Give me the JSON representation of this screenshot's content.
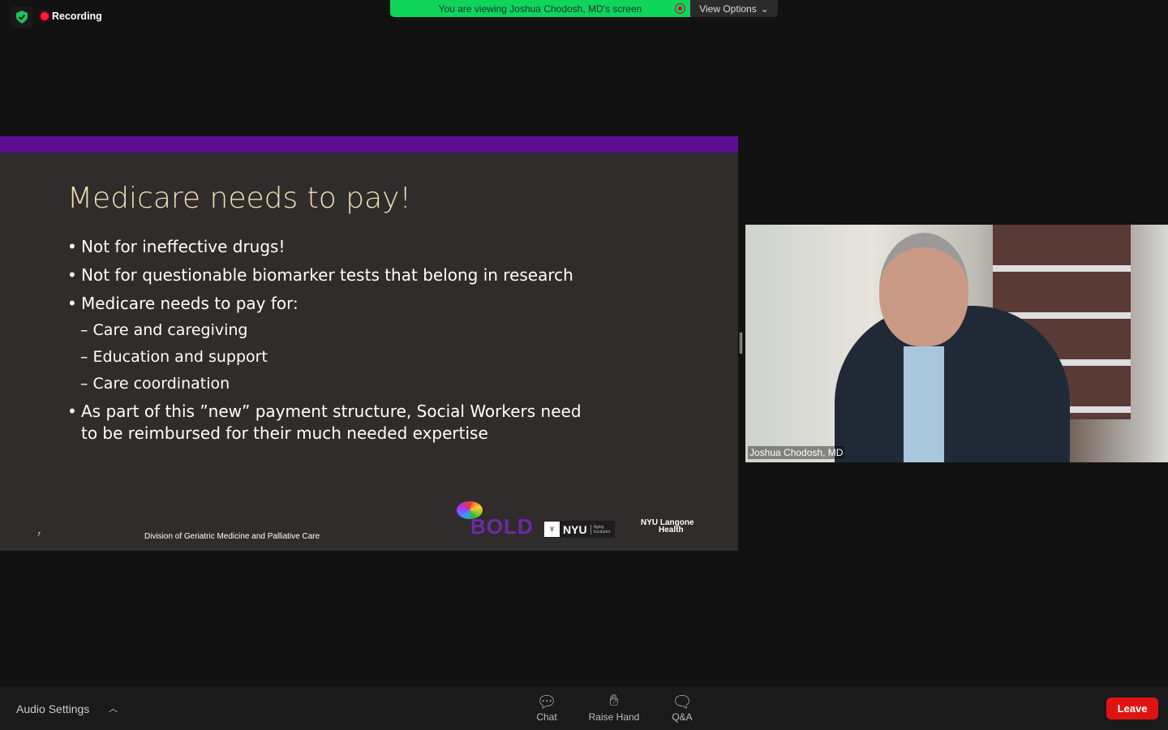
{
  "top": {
    "recording": "Recording",
    "banner": "You are viewing Joshua Chodosh, MD's screen",
    "view_options": "View Options"
  },
  "slide": {
    "title": "Medicare needs to pay!",
    "bullets": [
      "Not for ineffective drugs!",
      "Not for questionable biomarker tests that belong in research",
      "Medicare needs to pay for:",
      "As part of this ”new” payment structure, Social Workers need to be reimbursed for their much needed expertise"
    ],
    "subs": [
      "– Care and caregiving",
      "– Education and support",
      "– Care coordination"
    ],
    "page": "7",
    "footer": "Division of Geriatric Medicine and Palliative Care",
    "logos": {
      "bold": "BOLD",
      "nyu": "NYU",
      "nyu_sub": "Aging Incubator",
      "langone": "NYU Langone",
      "langone2": "Health"
    }
  },
  "video": {
    "name": "Joshua Chodosh, MD"
  },
  "toolbar": {
    "audio": "Audio Settings",
    "chat": "Chat",
    "raise": "Raise Hand",
    "qa": "Q&A",
    "leave": "Leave"
  }
}
